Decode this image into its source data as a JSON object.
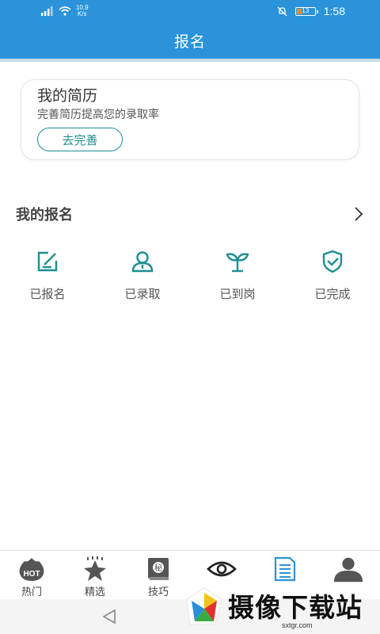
{
  "status_bar": {
    "speed_top": "10.9",
    "speed_bottom": "K/s",
    "battery": "13",
    "time": "1:58"
  },
  "header": {
    "title": "报名"
  },
  "resume": {
    "title": "我的简历",
    "subtitle": "完善简历提高您的录取率",
    "button": "去完善"
  },
  "my_applications": {
    "title": "我的报名",
    "items": [
      {
        "label": "已报名",
        "icon": "edit-icon"
      },
      {
        "label": "已录取",
        "icon": "person-icon"
      },
      {
        "label": "已到岗",
        "icon": "sprout-icon"
      },
      {
        "label": "已完成",
        "icon": "shield-check-icon"
      }
    ]
  },
  "tabbar": {
    "items": [
      {
        "label": "热门",
        "icon": "hot-flame-icon",
        "badge": "HOT"
      },
      {
        "label": "精选",
        "icon": "star-icon"
      },
      {
        "label": "技巧",
        "icon": "secret-book-icon",
        "badge": "秘"
      },
      {
        "label": "",
        "icon": "eye-icon"
      },
      {
        "label": "",
        "icon": "document-icon"
      },
      {
        "label": "",
        "icon": "profile-icon"
      }
    ]
  },
  "watermark": {
    "text": "摄像下载站",
    "url": "sxtgr.com"
  },
  "colors": {
    "primary": "#2a93da",
    "accent": "#1e8e92",
    "active_tab": "#2a93da"
  }
}
